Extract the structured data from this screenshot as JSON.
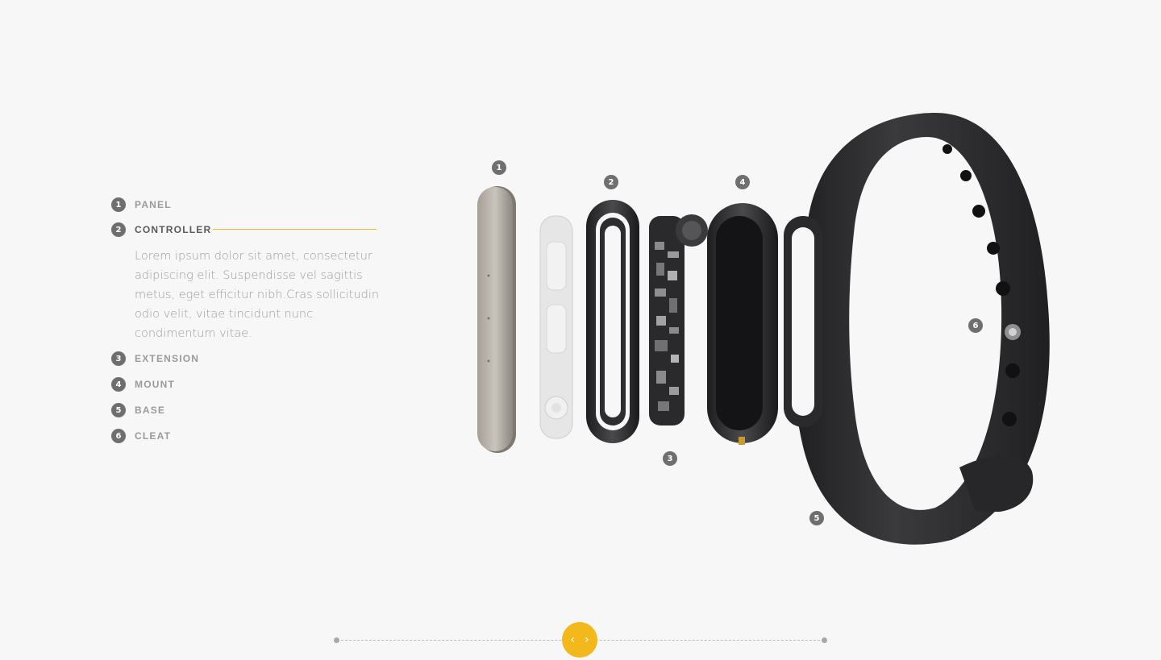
{
  "parts": [
    {
      "num": "1",
      "label": "PANEL"
    },
    {
      "num": "2",
      "label": "CONTROLLER"
    },
    {
      "num": "3",
      "label": "EXTENSION"
    },
    {
      "num": "4",
      "label": "MOUNT"
    },
    {
      "num": "5",
      "label": "BASE"
    },
    {
      "num": "6",
      "label": "CLEAT"
    }
  ],
  "active_description": "Lorem ipsum dolor sit amet, consectetur adipiscing elit. Suspendisse vel sagittis metus, eget efficitur nibh.Cras sollicitudin odio velit, vitae tincidunt nunc condimentum vitae.",
  "callouts": [
    "1",
    "2",
    "3",
    "4",
    "5",
    "6"
  ],
  "pager": {
    "prev_icon": "‹",
    "next_icon": "›"
  },
  "colors": {
    "accent": "#f2b81c",
    "badge": "#6f6f6f",
    "band": "#2c2c2e"
  }
}
